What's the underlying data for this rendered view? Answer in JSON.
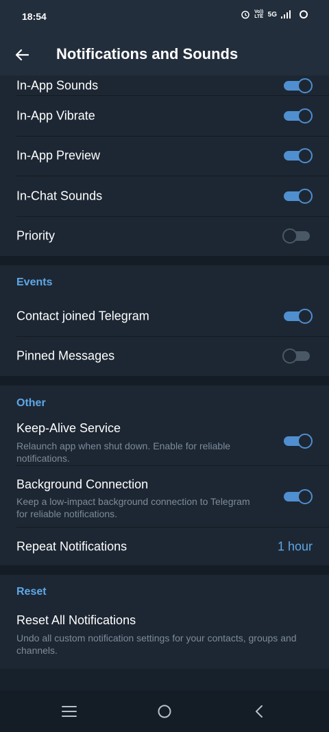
{
  "status": {
    "time": "18:54",
    "volte_label": "Vo)) LTE",
    "network_label": "5G",
    "icons": [
      "alarm-icon",
      "volte-icon",
      "5g-icon",
      "signal-icon",
      "sync-icon"
    ]
  },
  "header": {
    "title": "Notifications and Sounds",
    "back_icon": "arrow-left-icon"
  },
  "in_app": {
    "items": [
      {
        "label": "In-App Sounds",
        "enabled": true
      },
      {
        "label": "In-App Vibrate",
        "enabled": true
      },
      {
        "label": "In-App Preview",
        "enabled": true
      },
      {
        "label": "In-Chat Sounds",
        "enabled": true
      },
      {
        "label": "Priority",
        "enabled": false
      }
    ]
  },
  "events": {
    "header": "Events",
    "items": [
      {
        "label": "Contact joined Telegram",
        "enabled": true
      },
      {
        "label": "Pinned Messages",
        "enabled": false
      }
    ]
  },
  "other": {
    "header": "Other",
    "keep_alive": {
      "title": "Keep-Alive Service",
      "description": "Relaunch app when shut down. Enable for reliable notifications.",
      "enabled": true
    },
    "background": {
      "title": "Background Connection",
      "description": "Keep a low-impact background connection to Telegram for reliable notifications.",
      "enabled": true
    },
    "repeat": {
      "label": "Repeat Notifications",
      "value": "1 hour"
    }
  },
  "reset": {
    "header": "Reset",
    "reset_all": {
      "title": "Reset All Notifications",
      "description": "Undo all custom notification settings for your contacts, groups and channels."
    }
  },
  "navbar": {
    "icons": [
      "menu-icon",
      "home-icon",
      "back-icon"
    ]
  },
  "colors": {
    "accent": "#5ea8e8",
    "toggle_on": "#4f8fd0",
    "toggle_off": "#4a5866",
    "background": "#1d2733",
    "header": "#232e3c"
  }
}
